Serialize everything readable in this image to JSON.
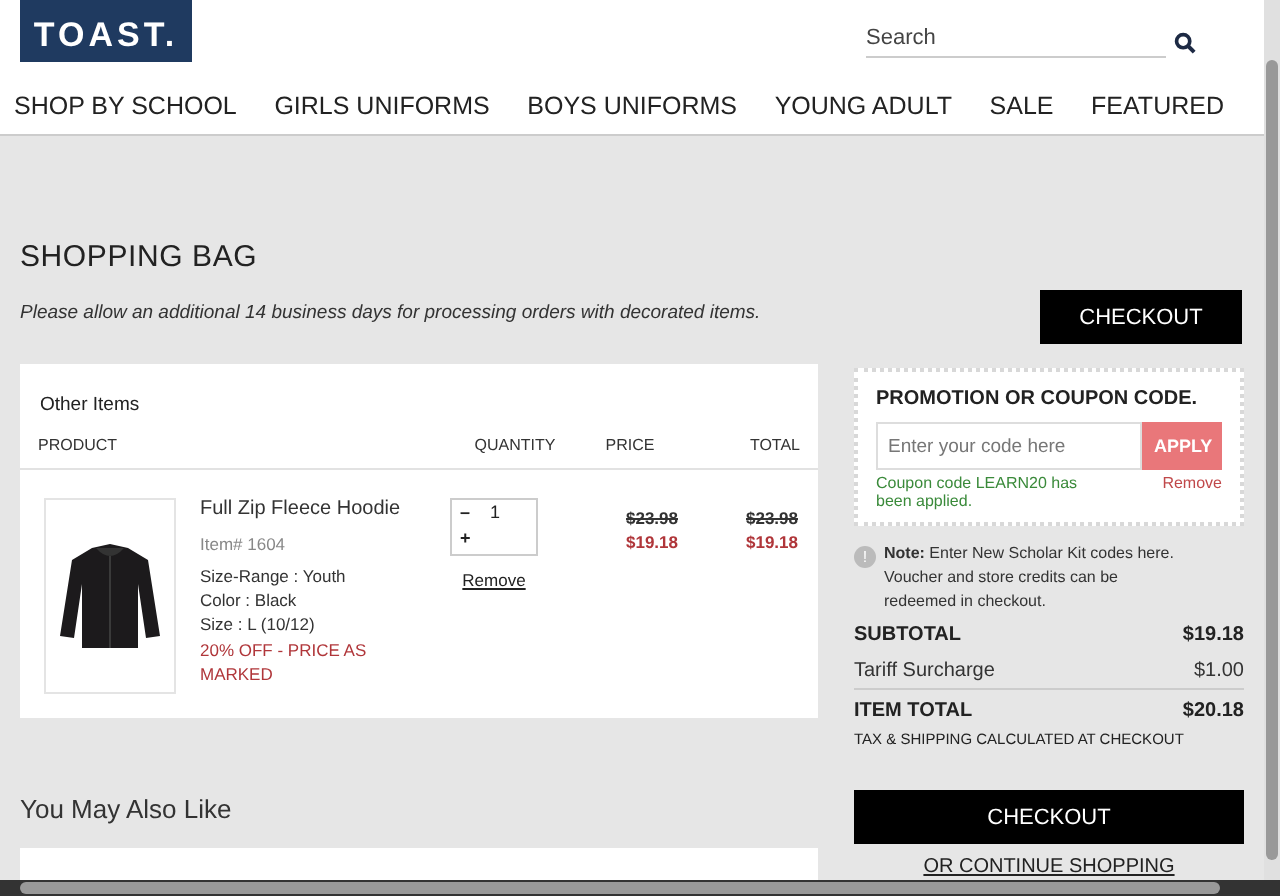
{
  "logo": {
    "text": "TOAST."
  },
  "search": {
    "placeholder": "Search"
  },
  "nav": [
    "SHOP BY SCHOOL",
    "GIRLS UNIFORMS",
    "BOYS UNIFORMS",
    "YOUNG ADULT",
    "SALE",
    "FEATURED"
  ],
  "page": {
    "title": "SHOPPING BAG",
    "note": "Please allow an additional 14 business days for processing orders with decorated items.",
    "checkout": "CHECKOUT"
  },
  "cart": {
    "section": "Other Items",
    "columns": [
      "PRODUCT",
      "QUANTITY",
      "PRICE",
      "TOTAL"
    ],
    "items": [
      {
        "name": "Full Zip Fleece Hoodie",
        "item_no": "Item# 1604",
        "details": [
          "Size-Range : Youth",
          "Color : Black",
          "Size : L (10/12)"
        ],
        "promo": "20% OFF - PRICE AS MARKED",
        "minus": "–",
        "quantity": "1",
        "plus": "+",
        "remove": "Remove",
        "price_old": "$23.98",
        "price": "$19.18",
        "total_old": "$23.98",
        "total": "$19.18"
      }
    ]
  },
  "promo": {
    "title": "PROMOTION OR COUPON CODE.",
    "placeholder": "Enter your code here",
    "apply": "APPLY",
    "applied": "Coupon code LEARN20 has been applied.",
    "remove": "Remove"
  },
  "info": {
    "icon": "!",
    "label": "Note:",
    "text": "Enter New Scholar Kit codes here. Voucher and store credits can be redeemed in checkout."
  },
  "summary": [
    {
      "label": "SUBTOTAL",
      "value": "$19.18",
      "kind": "bold"
    },
    {
      "label": "Tariff Surcharge",
      "value": "$1.00",
      "kind": "plain"
    },
    {
      "label": "ITEM TOTAL",
      "value": "$20.18",
      "kind": "bold"
    }
  ],
  "tax_note": "TAX & SHIPPING CALCULATED AT CHECKOUT",
  "checkout": "CHECKOUT",
  "continue": "OR CONTINUE SHOPPING",
  "also_like": {
    "title": "You May Also Like"
  }
}
